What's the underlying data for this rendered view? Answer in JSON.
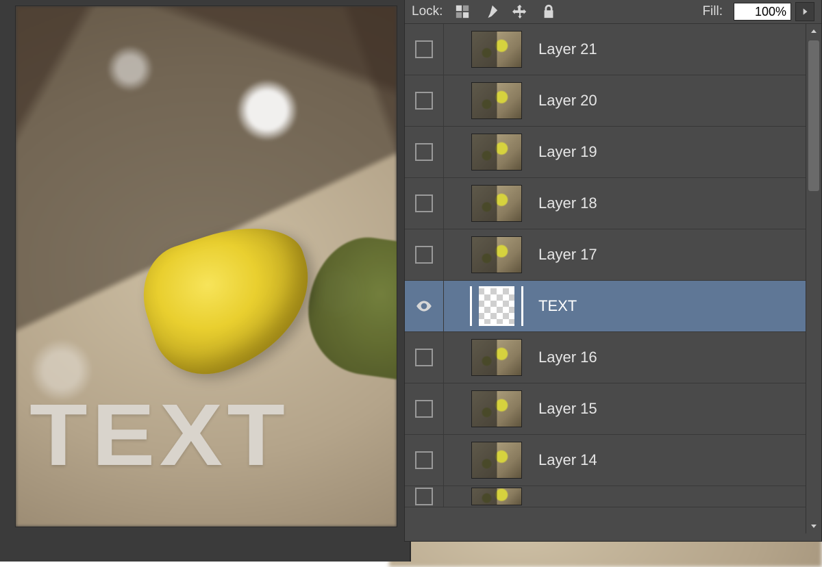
{
  "canvas": {
    "text": "TEXT"
  },
  "lockbar": {
    "label": "Lock:",
    "fill_label": "Fill:",
    "fill_value": "100%"
  },
  "layers": [
    {
      "name": "Layer 21",
      "visible": false,
      "selected": false,
      "thumb": "photo"
    },
    {
      "name": "Layer 20",
      "visible": false,
      "selected": false,
      "thumb": "photo"
    },
    {
      "name": "Layer 19",
      "visible": false,
      "selected": false,
      "thumb": "photo"
    },
    {
      "name": "Layer 18",
      "visible": false,
      "selected": false,
      "thumb": "photo"
    },
    {
      "name": "Layer 17",
      "visible": false,
      "selected": false,
      "thumb": "photo"
    },
    {
      "name": "TEXT",
      "visible": true,
      "selected": true,
      "thumb": "checker"
    },
    {
      "name": "Layer 16",
      "visible": false,
      "selected": false,
      "thumb": "photo"
    },
    {
      "name": "Layer 15",
      "visible": false,
      "selected": false,
      "thumb": "photo"
    },
    {
      "name": "Layer 14",
      "visible": false,
      "selected": false,
      "thumb": "photo"
    },
    {
      "name": "",
      "visible": false,
      "selected": false,
      "thumb": "photo",
      "partial": true
    }
  ]
}
